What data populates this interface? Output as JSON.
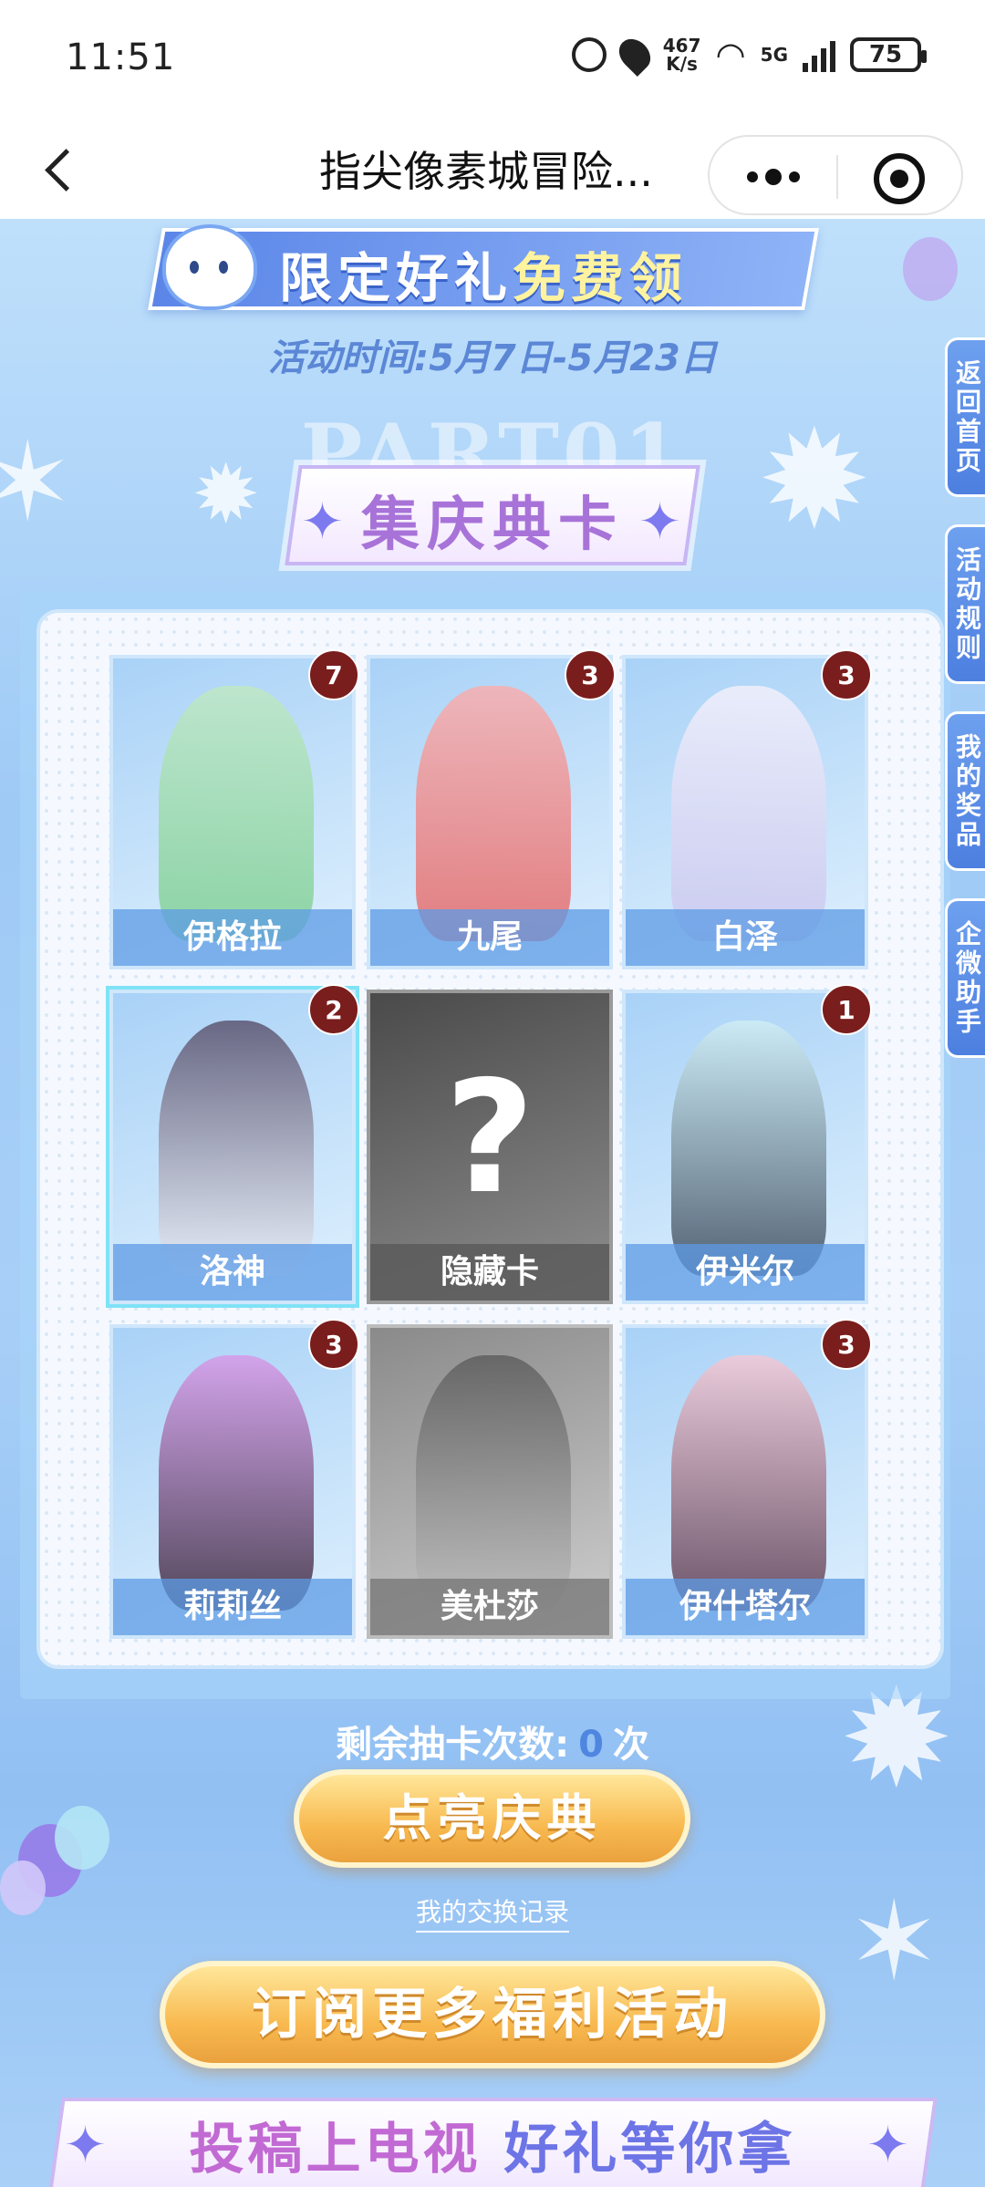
{
  "status_bar": {
    "time": "11:51",
    "net_speed_value": "467",
    "net_speed_unit": "K/s",
    "network": "5G",
    "battery": "75"
  },
  "nav": {
    "title": "指尖像素城冒险..."
  },
  "event": {
    "banner_prefix": "限定好礼",
    "banner_highlight": "免费领",
    "time_text": "活动时间:5月7日-5月23日",
    "part_watermark": "PART01",
    "section_title": "集庆典卡"
  },
  "cards": [
    {
      "name": "伊格拉",
      "count": "7"
    },
    {
      "name": "九尾",
      "count": "3"
    },
    {
      "name": "白泽",
      "count": "3"
    },
    {
      "name": "洛神",
      "count": "2"
    },
    {
      "name": "隐藏卡",
      "count": "",
      "symbol": "?"
    },
    {
      "name": "伊米尔",
      "count": "1"
    },
    {
      "name": "莉莉丝",
      "count": "3"
    },
    {
      "name": "美杜莎",
      "count": ""
    },
    {
      "name": "伊什塔尔",
      "count": "3"
    }
  ],
  "side_tabs": [
    "返回首页",
    "活动规则",
    "我的奖品",
    "企微助手"
  ],
  "draw": {
    "prefix": "剩余抽卡次数:",
    "count": "0",
    "suffix": "次"
  },
  "buttons": {
    "light_up": "点亮庆典",
    "exchange_record": "我的交换记录",
    "subscribe": "订阅更多福利活动"
  },
  "bottom_banner": {
    "part1": "投稿上电视",
    "part2": "好礼等你拿"
  },
  "colors": {
    "badge": "#7a1d1d",
    "accent_blue": "#4f86e0",
    "gold": "#f8b94f"
  }
}
